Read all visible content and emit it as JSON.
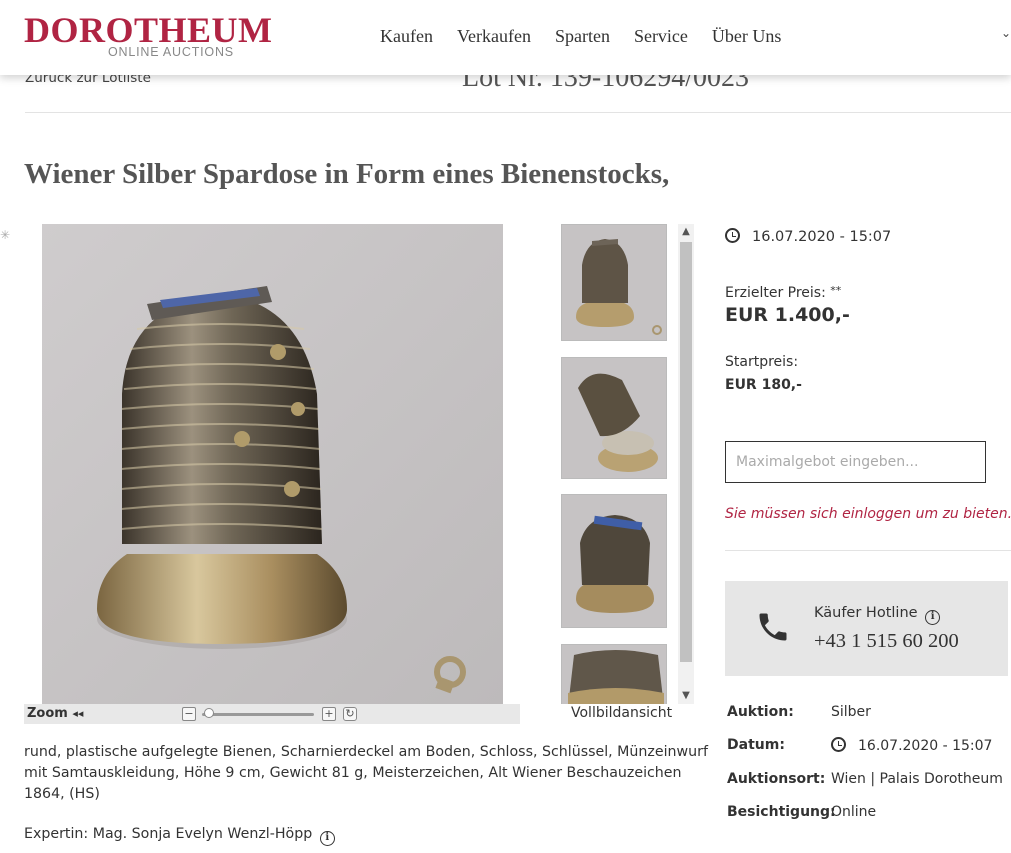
{
  "header": {
    "logo_main": "DOROTHEUM",
    "logo_sub": "ONLINE AUCTIONS",
    "nav": [
      "Kaufen",
      "Verkaufen",
      "Sparten",
      "Service",
      "Über Uns"
    ],
    "more_icon": "chevron-down-icon"
  },
  "subheader": {
    "back_link": "Zurück zur Lotliste",
    "lot_number": "Lot Nr. 139-106294/0023"
  },
  "title": "Wiener Silber Spardose in Form eines Bienenstocks,",
  "viewer": {
    "zoom_label": "Zoom",
    "zoom_arrows": "◂◂",
    "fullscreen_label": "Vollbildansicht",
    "thumbnail_count": 4
  },
  "description": "rund, plastische aufgelegte Bienen, Scharnierdeckel am Boden, Schloss, Schlüssel, Münzeinwurf mit Samtauskleidung, Höhe 9 cm, Gewicht 81 g, Meisterzeichen, Alt Wiener Beschauzeichen 1864, (HS)",
  "expert": "Expertin: Mag. Sonja Evelyn Wenzl-Höpp",
  "sidebar": {
    "date": "16.07.2020 - 15:07",
    "price_label": "Erzielter Preis:",
    "price_note": "**",
    "price_value": "EUR 1.400,-",
    "start_label": "Startpreis:",
    "start_value": "EUR 180,-",
    "bid_placeholder": "Maximalgebot eingeben...",
    "login_warning": "Sie müssen sich einloggen um zu bieten.",
    "hotline_label": "Käufer Hotline",
    "hotline_number": "+43 1 515 60 200"
  },
  "details": [
    {
      "key": "Auktion:",
      "value": "Silber"
    },
    {
      "key": "Datum:",
      "value": "16.07.2020 - 15:07"
    },
    {
      "key": "Auktionsort:",
      "value": "Wien | Palais Dorotheum"
    },
    {
      "key": "Besichtigung:",
      "value": "Online"
    }
  ],
  "colors": {
    "brand": "#b02443",
    "text": "#333333",
    "hotline_bg": "#e6e6e6"
  }
}
